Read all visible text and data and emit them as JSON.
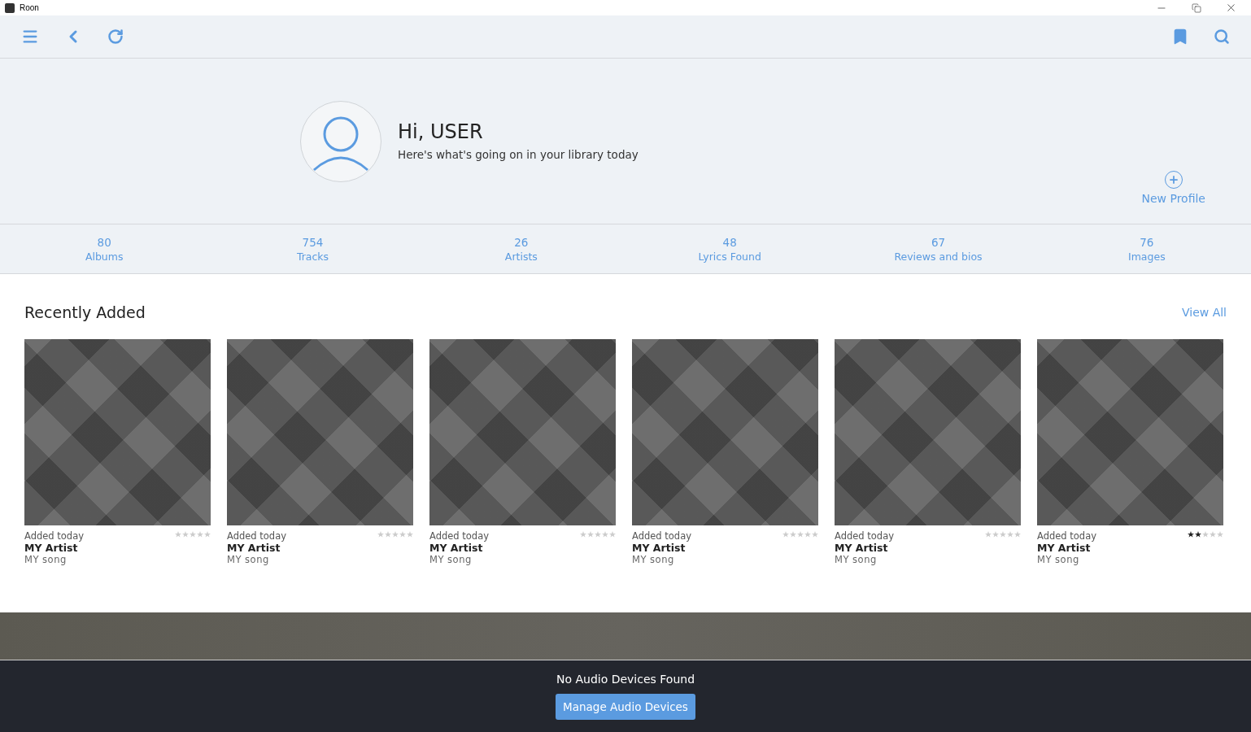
{
  "window": {
    "title": "Roon"
  },
  "greeting": {
    "title": "Hi, USER",
    "subtitle": "Here's what's going on in your library today",
    "new_profile": "New Profile"
  },
  "stats": [
    {
      "value": "80",
      "label": "Albums"
    },
    {
      "value": "754",
      "label": "Tracks"
    },
    {
      "value": "26",
      "label": "Artists"
    },
    {
      "value": "48",
      "label": "Lyrics Found"
    },
    {
      "value": "67",
      "label": "Reviews and bios"
    },
    {
      "value": "76",
      "label": "Images"
    }
  ],
  "recently_added": {
    "title": "Recently Added",
    "view_all": "View All",
    "albums": [
      {
        "added": "Added today",
        "artist": "MY Artist",
        "song": "MY song",
        "stars": 0
      },
      {
        "added": "Added today",
        "artist": "MY Artist",
        "song": "MY song",
        "stars": 0
      },
      {
        "added": "Added today",
        "artist": "MY Artist",
        "song": "MY song",
        "stars": 0
      },
      {
        "added": "Added today",
        "artist": "MY Artist",
        "song": "MY song",
        "stars": 0
      },
      {
        "added": "Added today",
        "artist": "MY Artist",
        "song": "MY song",
        "stars": 0
      },
      {
        "added": "Added today",
        "artist": "MY Artist",
        "song": "MY song",
        "stars": 2
      }
    ]
  },
  "footer": {
    "message": "No Audio Devices Found",
    "button": "Manage Audio Devices"
  }
}
